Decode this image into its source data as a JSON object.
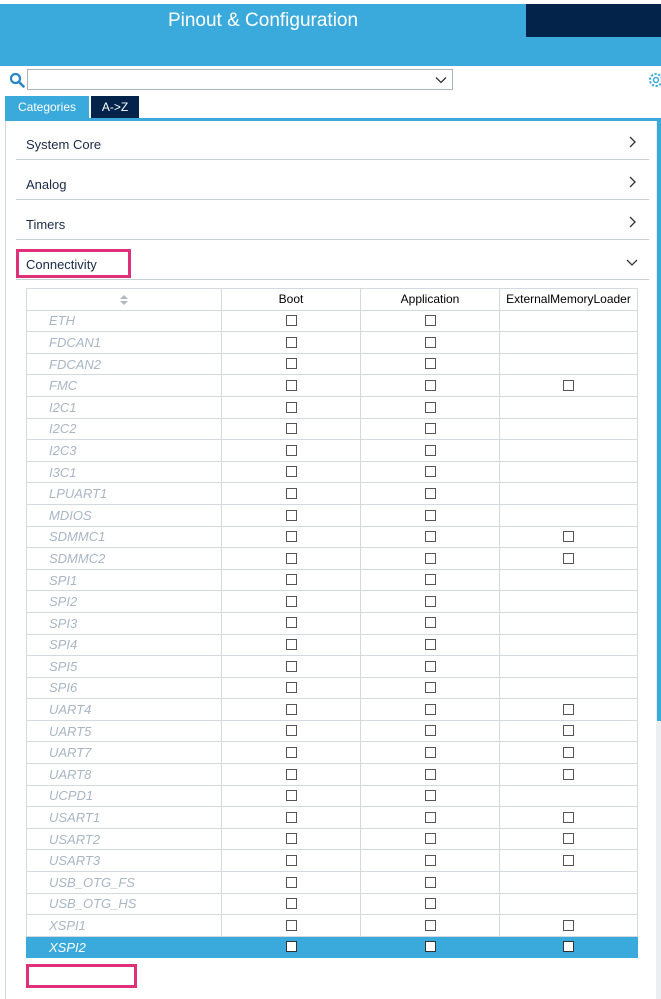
{
  "header": {
    "title": "Pinout & Configuration"
  },
  "search": {
    "value": ""
  },
  "tabs": [
    {
      "label": "Categories",
      "active": true
    },
    {
      "label": "A->Z",
      "active": false
    }
  ],
  "categories": [
    {
      "label": "System Core",
      "expanded": false
    },
    {
      "label": "Analog",
      "expanded": false
    },
    {
      "label": "Timers",
      "expanded": false
    },
    {
      "label": "Connectivity",
      "expanded": true
    }
  ],
  "table": {
    "columns": [
      "",
      "Boot",
      "Application",
      "ExternalMemoryLoader"
    ],
    "rows": [
      {
        "name": "ETH",
        "boot": true,
        "app": true,
        "eml": false
      },
      {
        "name": "FDCAN1",
        "boot": true,
        "app": true,
        "eml": false
      },
      {
        "name": "FDCAN2",
        "boot": true,
        "app": true,
        "eml": false
      },
      {
        "name": "FMC",
        "boot": true,
        "app": true,
        "eml": true
      },
      {
        "name": "I2C1",
        "boot": true,
        "app": true,
        "eml": false
      },
      {
        "name": "I2C2",
        "boot": true,
        "app": true,
        "eml": false
      },
      {
        "name": "I2C3",
        "boot": true,
        "app": true,
        "eml": false
      },
      {
        "name": "I3C1",
        "boot": true,
        "app": true,
        "eml": false
      },
      {
        "name": "LPUART1",
        "boot": true,
        "app": true,
        "eml": false
      },
      {
        "name": "MDIOS",
        "boot": true,
        "app": true,
        "eml": false
      },
      {
        "name": "SDMMC1",
        "boot": true,
        "app": true,
        "eml": true
      },
      {
        "name": "SDMMC2",
        "boot": true,
        "app": true,
        "eml": true
      },
      {
        "name": "SPI1",
        "boot": true,
        "app": true,
        "eml": false
      },
      {
        "name": "SPI2",
        "boot": true,
        "app": true,
        "eml": false
      },
      {
        "name": "SPI3",
        "boot": true,
        "app": true,
        "eml": false
      },
      {
        "name": "SPI4",
        "boot": true,
        "app": true,
        "eml": false
      },
      {
        "name": "SPI5",
        "boot": true,
        "app": true,
        "eml": false
      },
      {
        "name": "SPI6",
        "boot": true,
        "app": true,
        "eml": false
      },
      {
        "name": "UART4",
        "boot": true,
        "app": true,
        "eml": true
      },
      {
        "name": "UART5",
        "boot": true,
        "app": true,
        "eml": true
      },
      {
        "name": "UART7",
        "boot": true,
        "app": true,
        "eml": true
      },
      {
        "name": "UART8",
        "boot": true,
        "app": true,
        "eml": true
      },
      {
        "name": "UCPD1",
        "boot": true,
        "app": true,
        "eml": false
      },
      {
        "name": "USART1",
        "boot": true,
        "app": true,
        "eml": true
      },
      {
        "name": "USART2",
        "boot": true,
        "app": true,
        "eml": true
      },
      {
        "name": "USART3",
        "boot": true,
        "app": true,
        "eml": true
      },
      {
        "name": "USB_OTG_FS",
        "boot": true,
        "app": true,
        "eml": false
      },
      {
        "name": "USB_OTG_HS",
        "boot": true,
        "app": true,
        "eml": false
      },
      {
        "name": "XSPI1",
        "boot": true,
        "app": true,
        "eml": true
      },
      {
        "name": "XSPI2",
        "boot": true,
        "app": true,
        "eml": true,
        "selected": true
      }
    ]
  },
  "colors": {
    "accent": "#3aaadc",
    "dark": "#03234b",
    "highlight": "#e0307a",
    "disabled_text": "#a9b6c4"
  }
}
